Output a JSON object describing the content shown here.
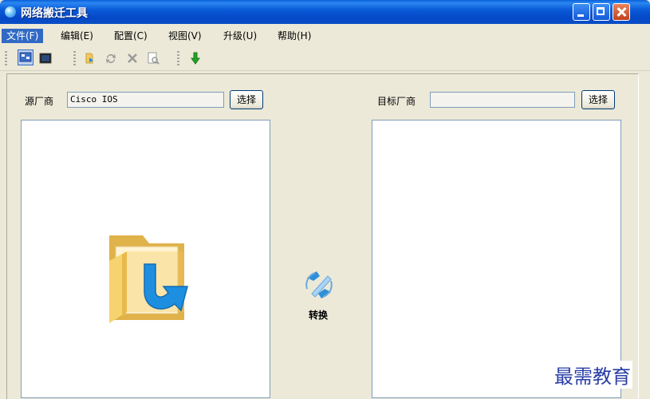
{
  "window": {
    "title": "网络搬迁工具"
  },
  "menu": [
    {
      "label": "文件(F)"
    },
    {
      "label": "编辑(E)"
    },
    {
      "label": "配置(C)"
    },
    {
      "label": "视图(V)"
    },
    {
      "label": "升级(U)"
    },
    {
      "label": "帮助(H)"
    }
  ],
  "toolbar": {
    "icons": [
      "network-view-icon",
      "console-icon",
      "import-icon",
      "refresh-icon",
      "delete-icon",
      "preview-icon",
      "download-icon"
    ]
  },
  "source": {
    "label": "源厂商",
    "value": "Cisco IOS",
    "button": "选择"
  },
  "target": {
    "label": "目标厂商",
    "value": "",
    "button": "选择"
  },
  "convert": {
    "label": "转换"
  },
  "watermark": "最需教育",
  "colors": {
    "titlebar": "#0a5fd9",
    "menu_active": "#316ac5",
    "panel_border": "#7f9db9",
    "folder": "#f3c75c",
    "arrow": "#1e8fe0"
  }
}
